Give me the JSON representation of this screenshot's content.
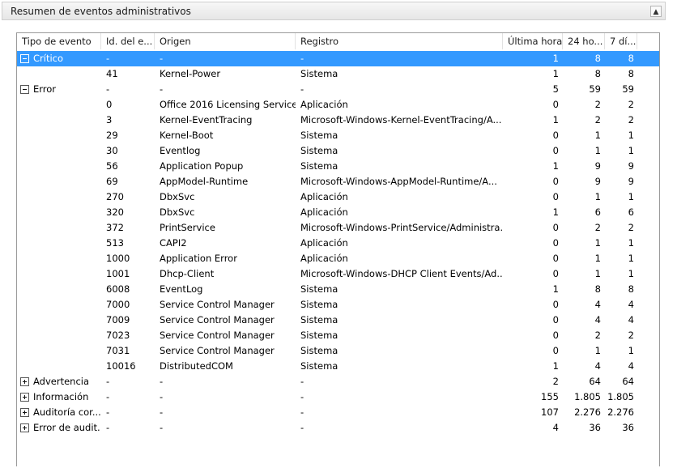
{
  "panel": {
    "title": "Resumen de eventos administrativos",
    "collapse_glyph": "▲"
  },
  "columns": [
    {
      "label": "Tipo de evento"
    },
    {
      "label": "Id. del e..."
    },
    {
      "label": "Origen"
    },
    {
      "label": "Registro"
    },
    {
      "label": "Última hora"
    },
    {
      "label": "24 ho..."
    },
    {
      "label": "7 dí..."
    }
  ],
  "rows": [
    {
      "type": "Crítico",
      "id": "-",
      "source": "-",
      "log": "-",
      "h": "1",
      "d": "8",
      "w": "8",
      "level": 0,
      "expander": "minus",
      "selected": true
    },
    {
      "type": "",
      "id": "41",
      "source": "Kernel-Power",
      "log": "Sistema",
      "h": "1",
      "d": "8",
      "w": "8",
      "level": 1
    },
    {
      "type": "Error",
      "id": "-",
      "source": "-",
      "log": "-",
      "h": "5",
      "d": "59",
      "w": "59",
      "level": 0,
      "expander": "minus"
    },
    {
      "type": "",
      "id": "0",
      "source": "Office 2016 Licensing Service",
      "log": "Aplicación",
      "h": "0",
      "d": "2",
      "w": "2",
      "level": 1
    },
    {
      "type": "",
      "id": "3",
      "source": "Kernel-EventTracing",
      "log": "Microsoft-Windows-Kernel-EventTracing/A...",
      "h": "1",
      "d": "2",
      "w": "2",
      "level": 1
    },
    {
      "type": "",
      "id": "29",
      "source": "Kernel-Boot",
      "log": "Sistema",
      "h": "0",
      "d": "1",
      "w": "1",
      "level": 1
    },
    {
      "type": "",
      "id": "30",
      "source": "Eventlog",
      "log": "Sistema",
      "h": "0",
      "d": "1",
      "w": "1",
      "level": 1
    },
    {
      "type": "",
      "id": "56",
      "source": "Application Popup",
      "log": "Sistema",
      "h": "1",
      "d": "9",
      "w": "9",
      "level": 1
    },
    {
      "type": "",
      "id": "69",
      "source": "AppModel-Runtime",
      "log": "Microsoft-Windows-AppModel-Runtime/A...",
      "h": "0",
      "d": "9",
      "w": "9",
      "level": 1
    },
    {
      "type": "",
      "id": "270",
      "source": "DbxSvc",
      "log": "Aplicación",
      "h": "0",
      "d": "1",
      "w": "1",
      "level": 1
    },
    {
      "type": "",
      "id": "320",
      "source": "DbxSvc",
      "log": "Aplicación",
      "h": "1",
      "d": "6",
      "w": "6",
      "level": 1
    },
    {
      "type": "",
      "id": "372",
      "source": "PrintService",
      "log": "Microsoft-Windows-PrintService/Administra...",
      "h": "0",
      "d": "2",
      "w": "2",
      "level": 1
    },
    {
      "type": "",
      "id": "513",
      "source": "CAPI2",
      "log": "Aplicación",
      "h": "0",
      "d": "1",
      "w": "1",
      "level": 1
    },
    {
      "type": "",
      "id": "1000",
      "source": "Application Error",
      "log": "Aplicación",
      "h": "0",
      "d": "1",
      "w": "1",
      "level": 1
    },
    {
      "type": "",
      "id": "1001",
      "source": "Dhcp-Client",
      "log": "Microsoft-Windows-DHCP Client Events/Ad...",
      "h": "0",
      "d": "1",
      "w": "1",
      "level": 1
    },
    {
      "type": "",
      "id": "6008",
      "source": "EventLog",
      "log": "Sistema",
      "h": "1",
      "d": "8",
      "w": "8",
      "level": 1
    },
    {
      "type": "",
      "id": "7000",
      "source": "Service Control Manager",
      "log": "Sistema",
      "h": "0",
      "d": "4",
      "w": "4",
      "level": 1
    },
    {
      "type": "",
      "id": "7009",
      "source": "Service Control Manager",
      "log": "Sistema",
      "h": "0",
      "d": "4",
      "w": "4",
      "level": 1
    },
    {
      "type": "",
      "id": "7023",
      "source": "Service Control Manager",
      "log": "Sistema",
      "h": "0",
      "d": "2",
      "w": "2",
      "level": 1
    },
    {
      "type": "",
      "id": "7031",
      "source": "Service Control Manager",
      "log": "Sistema",
      "h": "0",
      "d": "1",
      "w": "1",
      "level": 1
    },
    {
      "type": "",
      "id": "10016",
      "source": "DistributedCOM",
      "log": "Sistema",
      "h": "1",
      "d": "4",
      "w": "4",
      "level": 1
    },
    {
      "type": "Advertencia",
      "id": "-",
      "source": "-",
      "log": "-",
      "h": "2",
      "d": "64",
      "w": "64",
      "level": 0,
      "expander": "plus"
    },
    {
      "type": "Información",
      "id": "-",
      "source": "-",
      "log": "-",
      "h": "155",
      "d": "1.805",
      "w": "1.805",
      "level": 0,
      "expander": "plus"
    },
    {
      "type": "Auditoría cor...",
      "id": "-",
      "source": "-",
      "log": "-",
      "h": "107",
      "d": "2.276",
      "w": "2.276",
      "level": 0,
      "expander": "plus"
    },
    {
      "type": "Error de audit...",
      "id": "-",
      "source": "-",
      "log": "-",
      "h": "4",
      "d": "36",
      "w": "36",
      "level": 0,
      "expander": "plus"
    }
  ],
  "colors": {
    "selection": "#3399ff",
    "selection_text": "#ffffff"
  }
}
